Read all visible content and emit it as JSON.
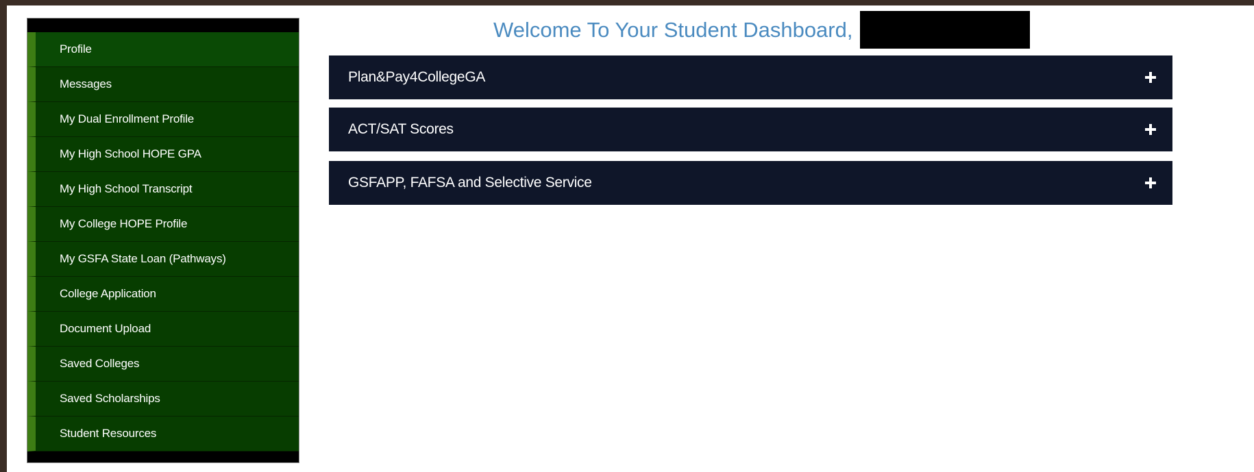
{
  "header": {
    "welcome": "Welcome To Your Student Dashboard,"
  },
  "sidebar": {
    "items": [
      {
        "label": "Profile",
        "active": true
      },
      {
        "label": "Messages"
      },
      {
        "label": "My Dual Enrollment Profile"
      },
      {
        "label": "My High School HOPE GPA"
      },
      {
        "label": "My High School Transcript"
      },
      {
        "label": "My College HOPE Profile"
      },
      {
        "label": "My GSFA State Loan (Pathways)"
      },
      {
        "label": "College Application"
      },
      {
        "label": "Document Upload"
      },
      {
        "label": "Saved Colleges"
      },
      {
        "label": "Saved Scholarships"
      },
      {
        "label": "Student Resources"
      }
    ]
  },
  "main": {
    "panels": [
      {
        "title": "Plan&Pay4CollegeGA",
        "icon": "plus-icon"
      },
      {
        "title": "ACT/SAT Scores",
        "icon": "plus-icon"
      },
      {
        "title": "GSFAPP, FAFSA and Selective Service",
        "icon": "plus-icon"
      }
    ]
  },
  "colors": {
    "sidebar_bg": "#073d00",
    "sidebar_accent": "#3d7d14",
    "panel_bg": "#0f1629",
    "welcome_text": "#4b8bc0"
  }
}
